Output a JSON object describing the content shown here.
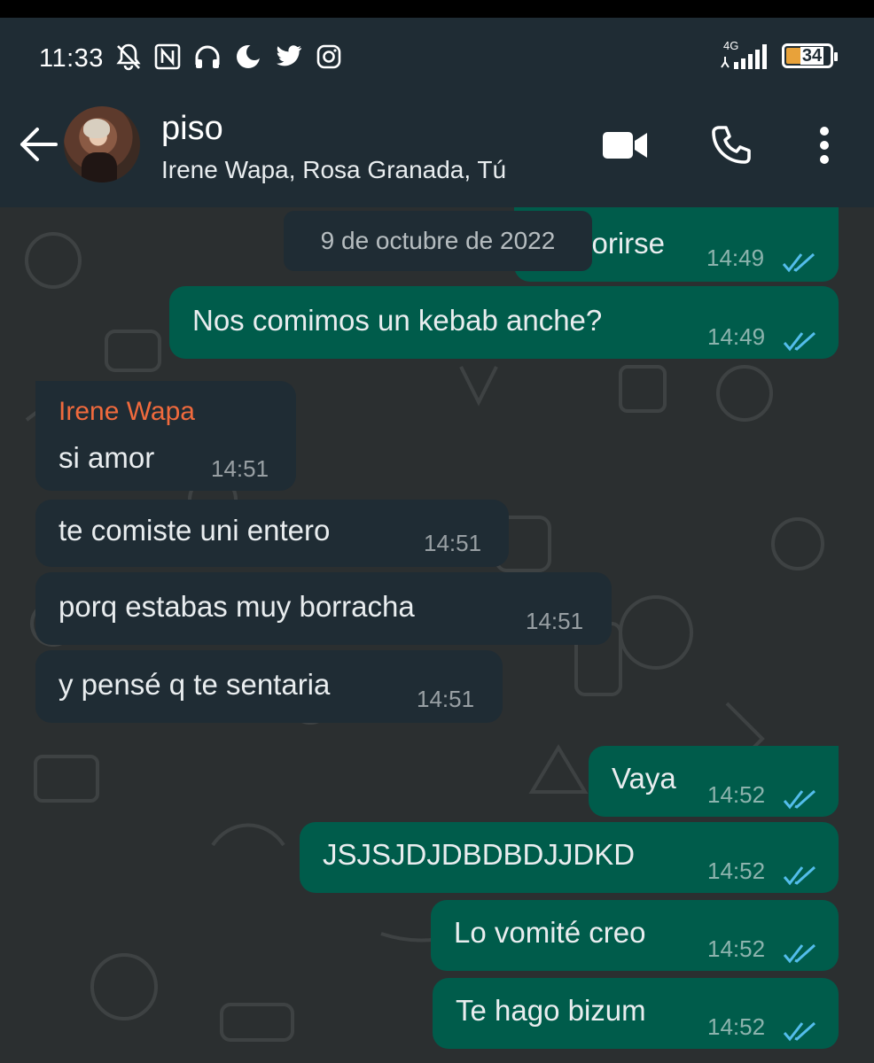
{
  "status_bar": {
    "time": "11:33",
    "network": "4G",
    "battery": "34"
  },
  "header": {
    "title": "piso",
    "subtitle": "Irene Wapa, Rosa Granada, Tú"
  },
  "date_pill": "9 de octubre de 2022",
  "messages": [
    {
      "dir": "out",
      "text": "morirse",
      "time": "14:49",
      "ticks": "read"
    },
    {
      "dir": "out",
      "text": "Nos comimos un kebab anche?",
      "time": "14:49",
      "ticks": "read"
    },
    {
      "dir": "in",
      "sender": "Irene Wapa",
      "text": "si amor",
      "time": "14:51"
    },
    {
      "dir": "in",
      "text": "te comiste uni entero",
      "time": "14:51"
    },
    {
      "dir": "in",
      "text": "porq estabas muy borracha",
      "time": "14:51"
    },
    {
      "dir": "in",
      "text": "y pensé q te sentaria",
      "time": "14:51"
    },
    {
      "dir": "out",
      "text": "Vaya",
      "time": "14:52",
      "ticks": "read"
    },
    {
      "dir": "out",
      "text": "JSJSJDJDBDBDJJDKD",
      "time": "14:52",
      "ticks": "read"
    },
    {
      "dir": "out",
      "text": "Lo vomité creo",
      "time": "14:52",
      "ticks": "read"
    },
    {
      "dir": "out",
      "text": "Te hago bizum",
      "time": "14:52",
      "ticks": "read"
    }
  ],
  "icons": {
    "back": "arrow-left-icon",
    "video": "video-call-icon",
    "call": "phone-icon",
    "menu": "more-vert-icon"
  },
  "colors": {
    "header_bg": "#1f2c34",
    "outgoing_bubble": "#005c4b",
    "incoming_bubble": "#1f2c34",
    "sender_name": "#f06a3d",
    "read_ticks": "#53bdeb"
  }
}
